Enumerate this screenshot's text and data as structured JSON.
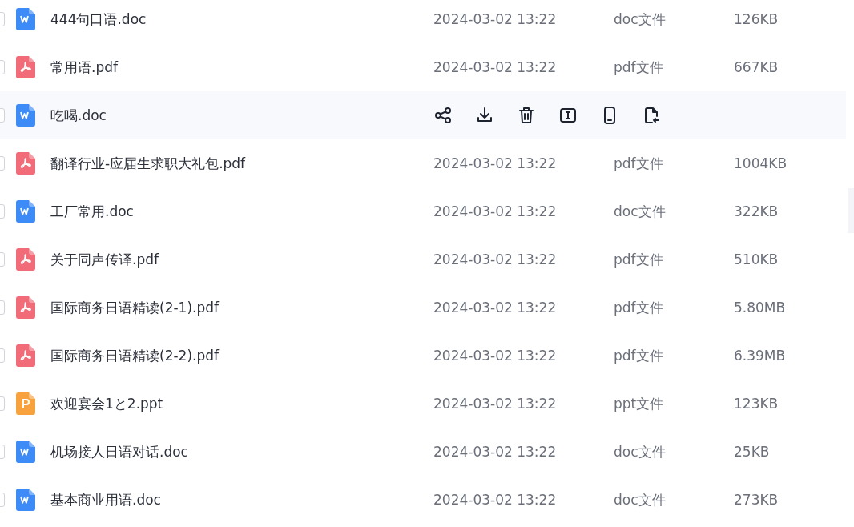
{
  "files": [
    {
      "name": "444句口语.doc",
      "kind": "doc",
      "date": "2024-03-02 13:22",
      "type": "doc文件",
      "size": "126KB",
      "checked": false,
      "hovered": false
    },
    {
      "name": "常用语.pdf",
      "kind": "pdf",
      "date": "2024-03-02 13:22",
      "type": "pdf文件",
      "size": "667KB",
      "checked": false,
      "hovered": false
    },
    {
      "name": "吃喝.doc",
      "kind": "doc",
      "checked": false,
      "hovered": true,
      "actions": [
        {
          "kind": "share"
        },
        {
          "kind": "download"
        },
        {
          "kind": "delete"
        },
        {
          "kind": "rename"
        },
        {
          "kind": "mobile"
        },
        {
          "kind": "move"
        }
      ]
    },
    {
      "name": "翻译行业-应届生求职大礼包.pdf",
      "kind": "pdf",
      "date": "2024-03-02 13:22",
      "type": "pdf文件",
      "size": "1004KB",
      "checked": false,
      "hovered": false
    },
    {
      "name": "工厂常用.doc",
      "kind": "doc",
      "date": "2024-03-02 13:22",
      "type": "doc文件",
      "size": "322KB",
      "checked": false,
      "hovered": false
    },
    {
      "name": "关于同声传译.pdf",
      "kind": "pdf",
      "date": "2024-03-02 13:22",
      "type": "pdf文件",
      "size": "510KB",
      "checked": false,
      "hovered": false
    },
    {
      "name": "国际商务日语精读(2-1).pdf",
      "kind": "pdf",
      "date": "2024-03-02 13:22",
      "type": "pdf文件",
      "size": "5.80MB",
      "checked": false,
      "hovered": false
    },
    {
      "name": "国际商务日语精读(2-2).pdf",
      "kind": "pdf",
      "date": "2024-03-02 13:22",
      "type": "pdf文件",
      "size": "6.39MB",
      "checked": false,
      "hovered": false
    },
    {
      "name": "欢迎宴会1と2.ppt",
      "kind": "ppt",
      "date": "2024-03-02 13:22",
      "type": "ppt文件",
      "size": "123KB",
      "checked": false,
      "hovered": false
    },
    {
      "name": "机场接人日语对话.doc",
      "kind": "doc",
      "date": "2024-03-02 13:22",
      "type": "doc文件",
      "size": "25KB",
      "checked": false,
      "hovered": false
    },
    {
      "name": "基本商业用语.doc",
      "kind": "doc",
      "date": "2024-03-02 13:22",
      "type": "doc文件",
      "size": "273KB",
      "checked": false,
      "hovered": false
    }
  ]
}
